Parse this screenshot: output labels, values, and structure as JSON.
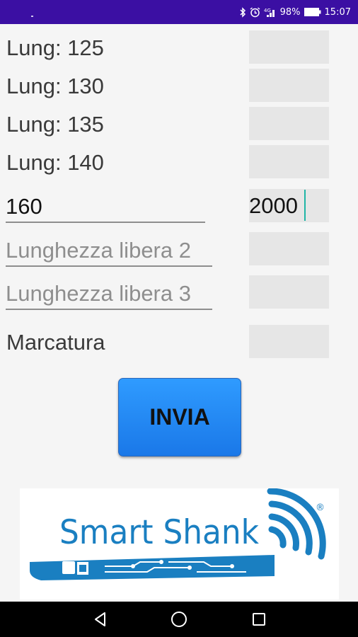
{
  "status_bar": {
    "battery": "98%",
    "time": "15:07",
    "icons": [
      "bluetooth-icon",
      "alarm-icon",
      "signal-icon",
      "battery-icon"
    ]
  },
  "form": {
    "rows": [
      {
        "label": "Lung: 125",
        "value": ""
      },
      {
        "label": "Lung: 130",
        "value": ""
      },
      {
        "label": "Lung: 135",
        "value": ""
      },
      {
        "label": "Lung: 140",
        "value": ""
      }
    ],
    "free_length_1": {
      "value": "160",
      "quantity": "2000"
    },
    "free_length_2": {
      "placeholder": "Lunghezza libera 2",
      "quantity": ""
    },
    "free_length_3": {
      "placeholder": "Lunghezza libera 3",
      "quantity": ""
    },
    "marking": {
      "label": "Marcatura",
      "value": ""
    },
    "submit_label": "INVIA"
  },
  "logo": {
    "text": "Smart Shank",
    "mark": "®"
  },
  "colors": {
    "status_bar": "#3b0fa3",
    "button": "#1f86f5",
    "logo_blue": "#1a7fc1",
    "cursor": "#1fb5a6"
  }
}
